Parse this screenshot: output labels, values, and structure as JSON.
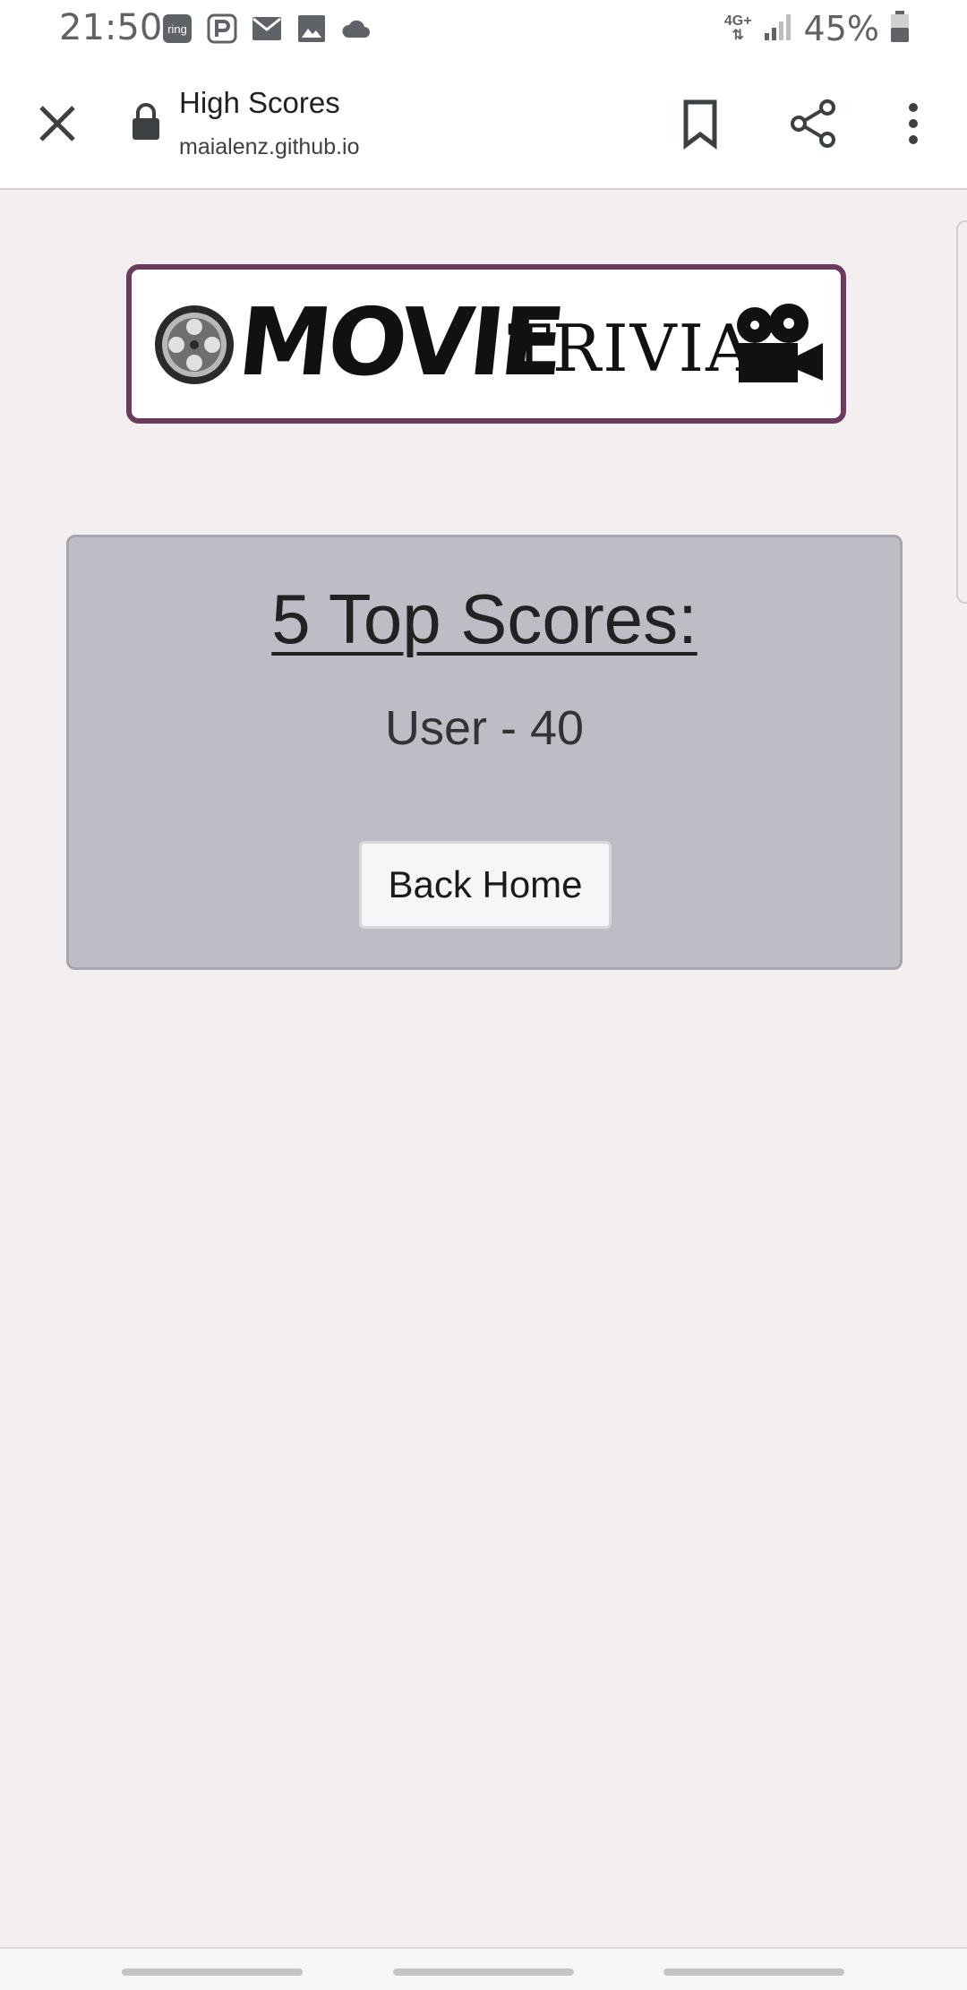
{
  "status_bar": {
    "time": "21:50",
    "notification_icons": [
      "ring-icon",
      "parking-icon",
      "mail-icon",
      "image-icon",
      "cloud-icon"
    ],
    "network": "4G+",
    "battery": "45%"
  },
  "toolbar": {
    "title": "High Scores",
    "url": "maialenz.github.io"
  },
  "logo": {
    "word1": "MOVIE",
    "word2": "TRIVIA"
  },
  "scores": {
    "heading": "5 Top Scores:",
    "items": [
      "User - 40"
    ]
  },
  "actions": {
    "back_home": "Back Home"
  },
  "colors": {
    "page_bg": "#f3eff0",
    "card_bg": "#c0bcc5",
    "logo_border": "#6b3a5e"
  }
}
